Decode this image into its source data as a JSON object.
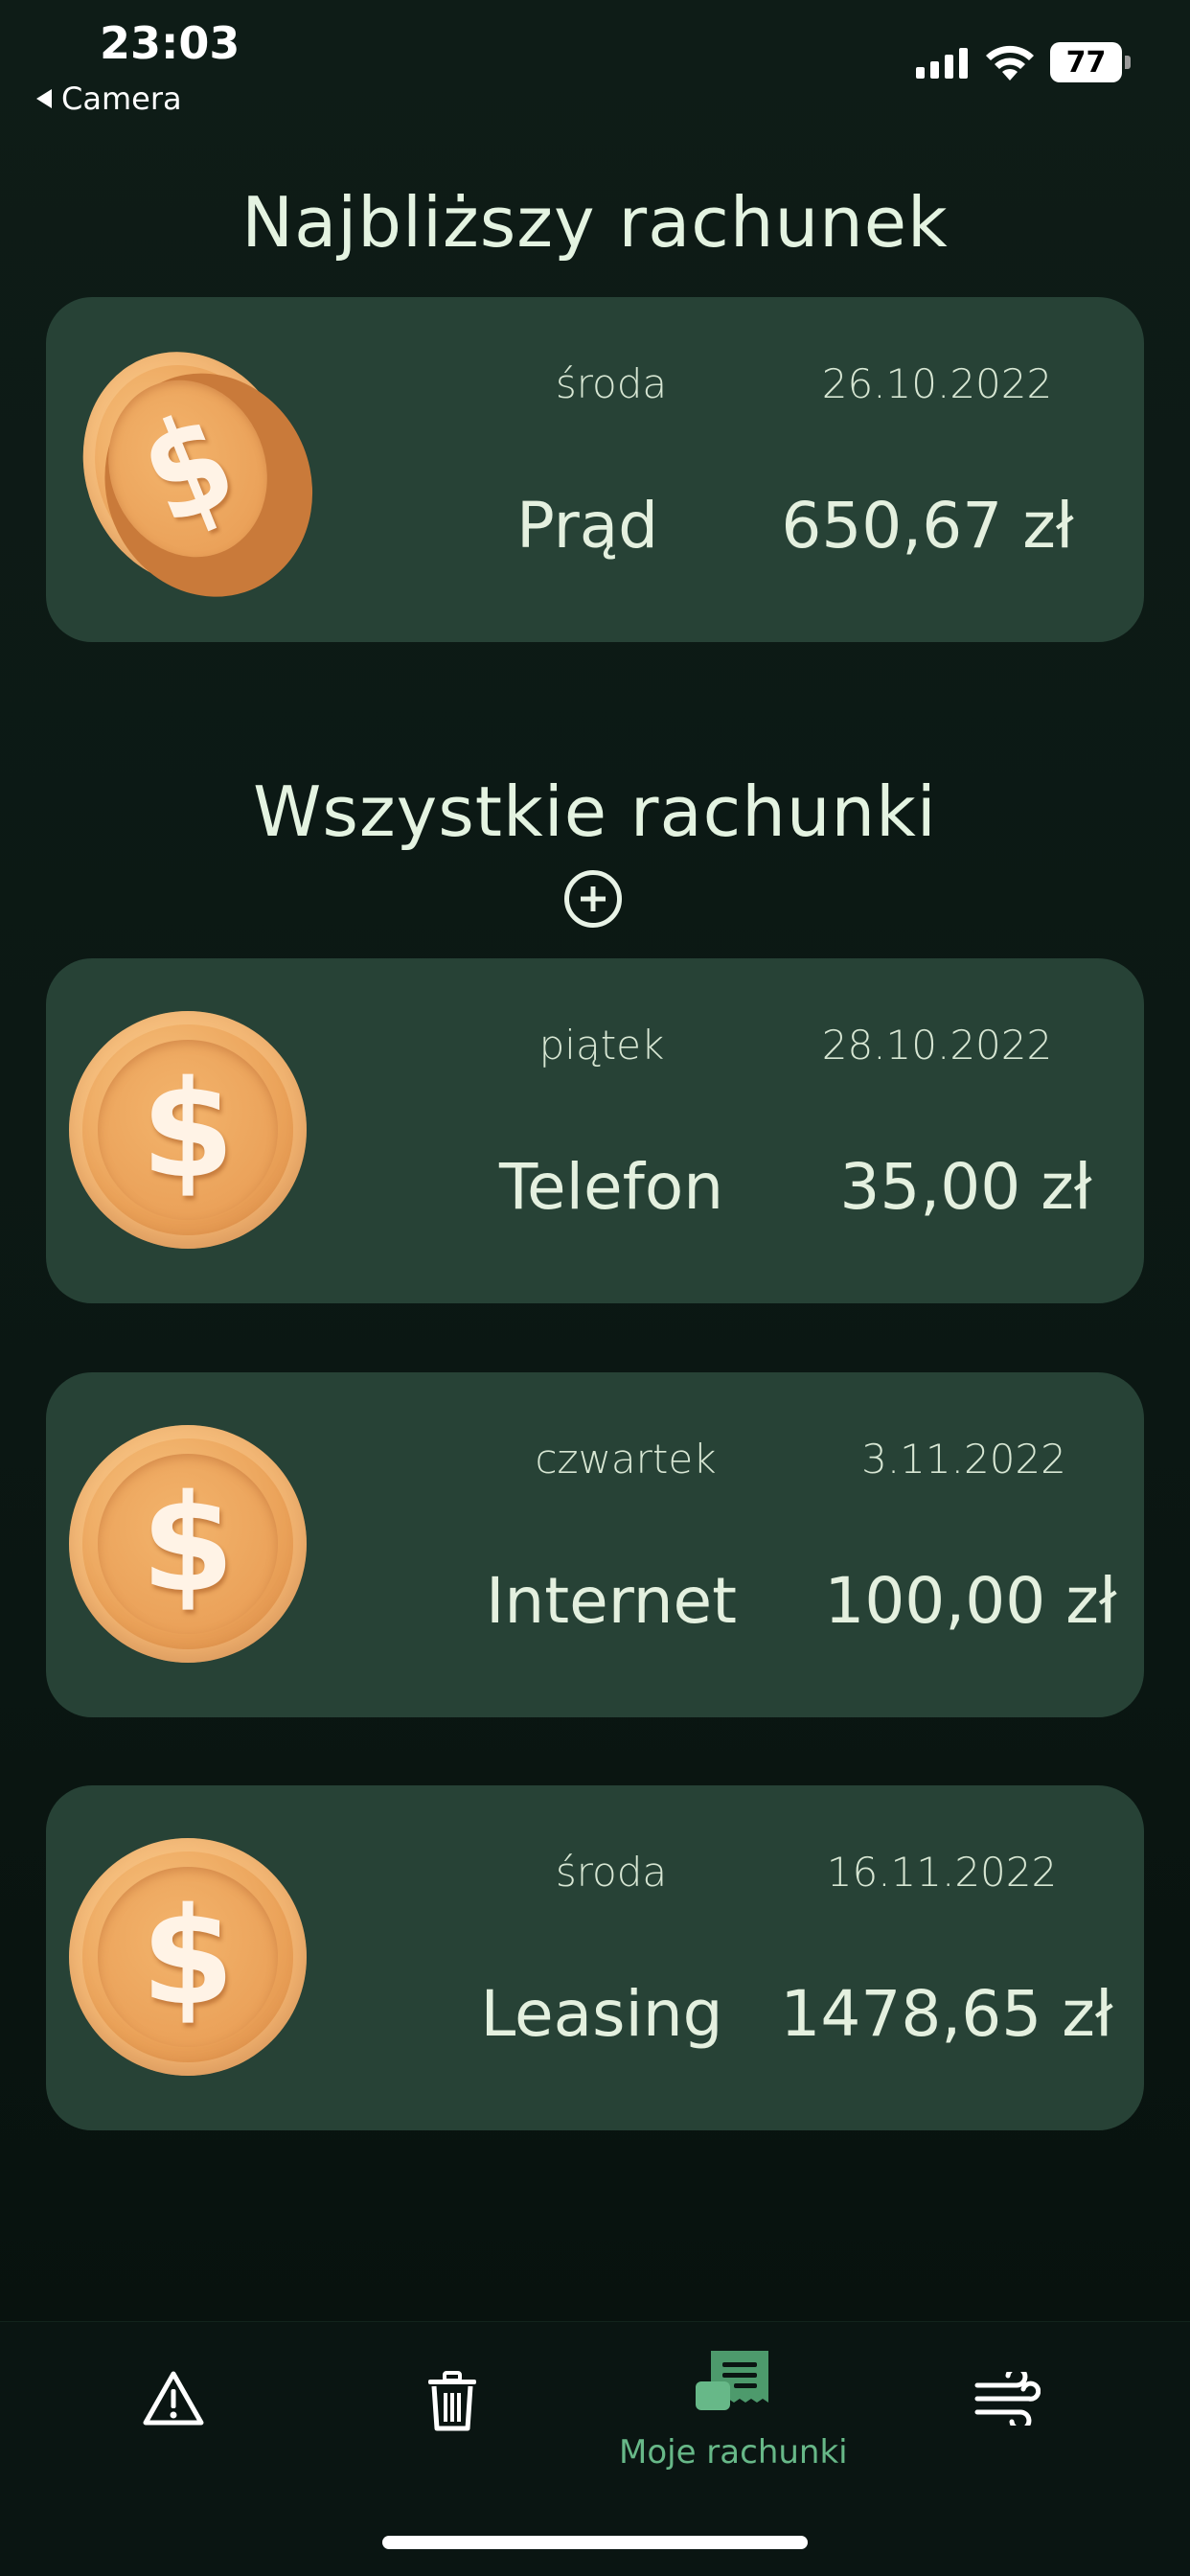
{
  "status_bar": {
    "time": "23:03",
    "back_label": "Camera",
    "battery": "77"
  },
  "next_bill": {
    "title": "Najbliższy rachunek",
    "day": "środa",
    "date": "26.10.2022",
    "name": "Prąd",
    "amount": "650,67 zł",
    "icon": "coin-icon"
  },
  "all_bills": {
    "title": "Wszystkie rachunki",
    "add_icon": "plus-circle-icon",
    "items": [
      {
        "day": "piątek",
        "date": "28.10.2022",
        "name": "Telefon",
        "amount": "35,00 zł",
        "icon": "coin-icon"
      },
      {
        "day": "czwartek",
        "date": "3.11.2022",
        "name": "Internet",
        "amount": "100,00 zł",
        "icon": "coin-icon"
      },
      {
        "day": "środa",
        "date": "16.11.2022",
        "name": "Leasing",
        "amount": "1478,65 zł",
        "icon": "coin-icon"
      }
    ]
  },
  "bottom_nav": {
    "items": [
      {
        "icon": "warning-icon",
        "label": ""
      },
      {
        "icon": "trash-icon",
        "label": ""
      },
      {
        "icon": "receipt-icon",
        "label": "Moje rachunki",
        "active": true
      },
      {
        "icon": "wind-icon",
        "label": ""
      }
    ]
  },
  "colors": {
    "background": "#0e1c17",
    "card": "#274236",
    "accent": "#67b888",
    "coin": "#eba35a"
  }
}
